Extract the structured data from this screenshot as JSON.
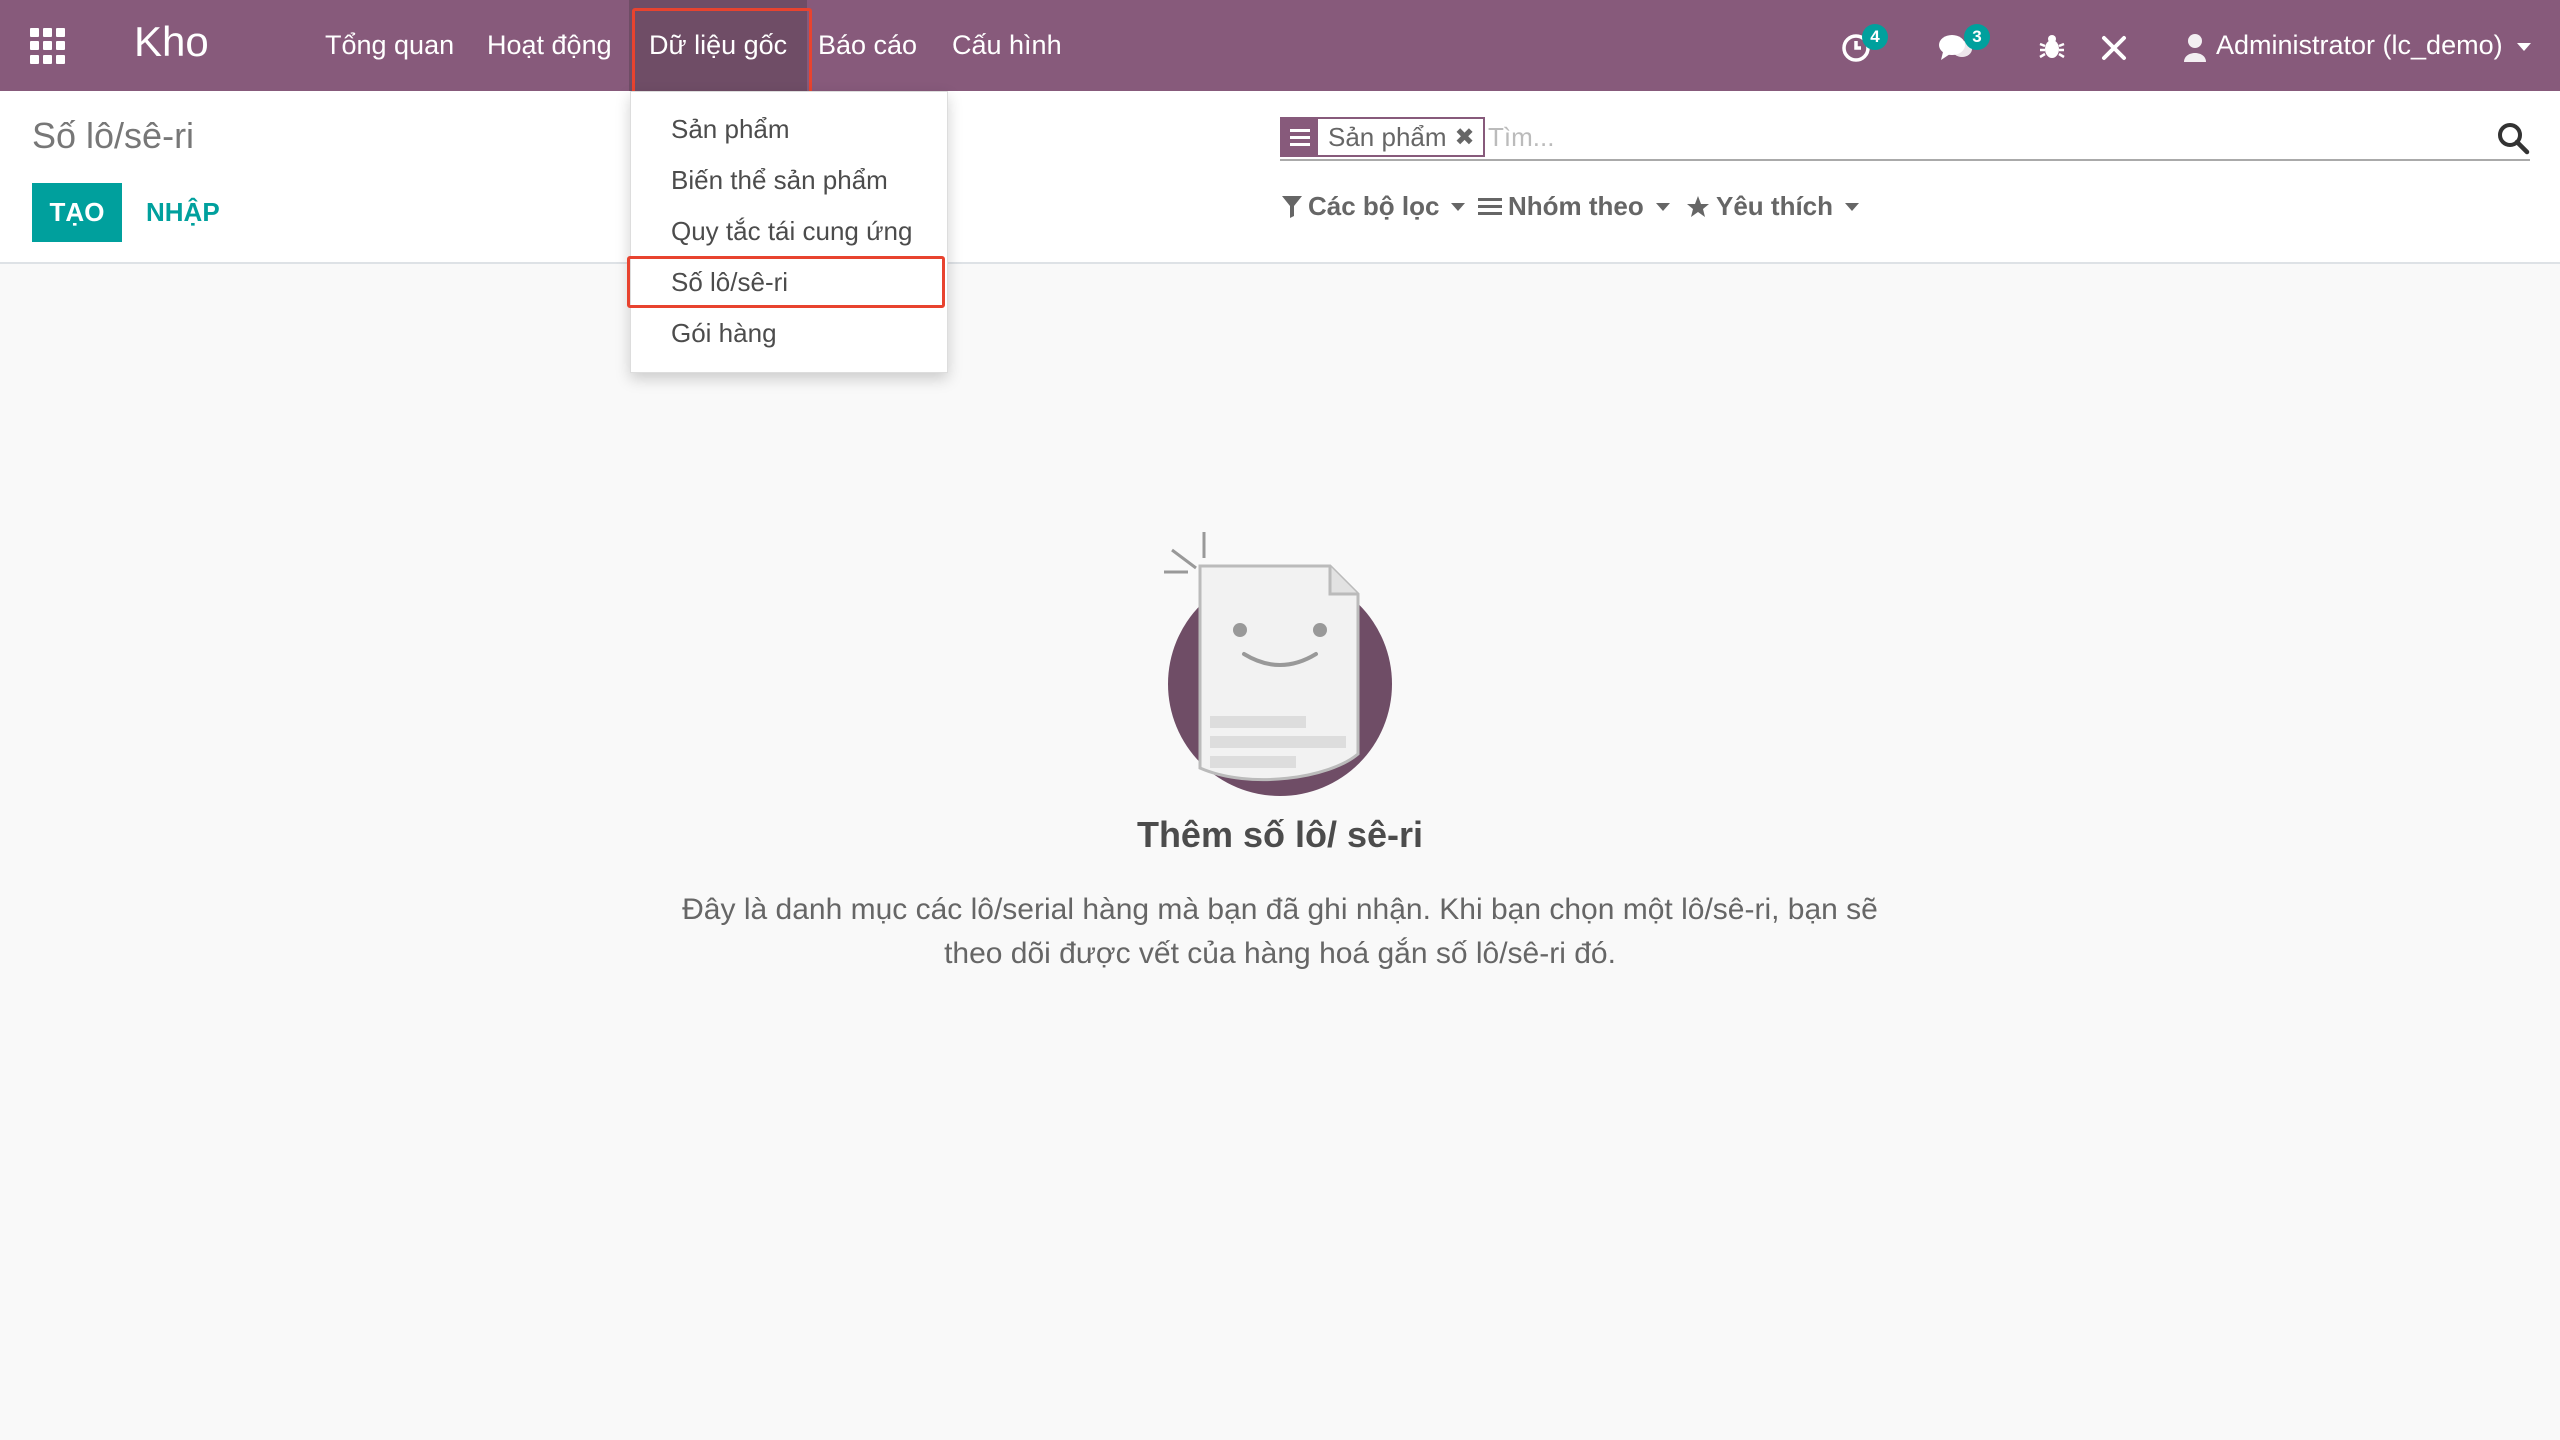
{
  "navbar": {
    "brand": "Kho",
    "menu": [
      "Tổng quan",
      "Hoạt động",
      "Dữ liệu gốc",
      "Báo cáo",
      "Cấu hình"
    ],
    "activity_count": "4",
    "message_count": "3",
    "user": "Administrator (lc_demo)",
    "bg_color": "#875a7b"
  },
  "page": {
    "title": "Số lô/sê-ri",
    "create_label": "TẠO",
    "import_label": "NHẬP"
  },
  "search": {
    "facet": "Sản phẩm",
    "placeholder": "Tìm...",
    "filters_label": "Các bộ lọc",
    "groupby_label": "Nhóm theo",
    "favorites_label": "Yêu thích"
  },
  "dropdown": {
    "items": [
      "Sản phẩm",
      "Biến thể sản phẩm",
      "Quy tắc tái cung ứng",
      "Số lô/sê-ri",
      "Gói hàng"
    ]
  },
  "empty": {
    "title": "Thêm số lô/ sê-ri",
    "line1": "Đây là danh mục các lô/serial hàng mà bạn đã ghi nhận. Khi bạn chọn một lô/sê-ri, bạn sẽ",
    "line2": "theo dõi được vết của hàng hoá gắn số lô/sê-ri đó."
  }
}
